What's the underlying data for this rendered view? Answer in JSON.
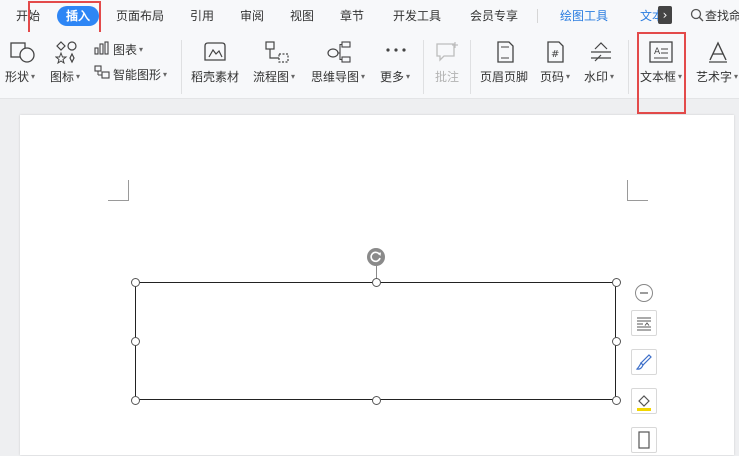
{
  "tabs": {
    "start": "开始",
    "insert": "插入",
    "page_layout": "页面布局",
    "references": "引用",
    "review": "审阅",
    "view": "视图",
    "chapter": "章节",
    "developer": "开发工具",
    "member": "会员专享",
    "drawing_tools": "绘图工具",
    "text_tools": "文本",
    "more_chevron": "›",
    "search": "查找命"
  },
  "ribbon": {
    "shape": "形状",
    "icon": "图标",
    "chart": "图表",
    "smart_shape": "智能图形",
    "docer_material": "稻壳素材",
    "flowchart": "流程图",
    "mindmap": "思维导图",
    "more": "更多",
    "comment": "批注",
    "header_footer": "页眉页脚",
    "page_number": "页码",
    "watermark": "水印",
    "textbox": "文本框",
    "wordart": "艺术字",
    "caret": "▾"
  },
  "colors": {
    "accent": "#2e86f5",
    "highlight_box": "#e34a4a",
    "link": "#2b7de0"
  }
}
